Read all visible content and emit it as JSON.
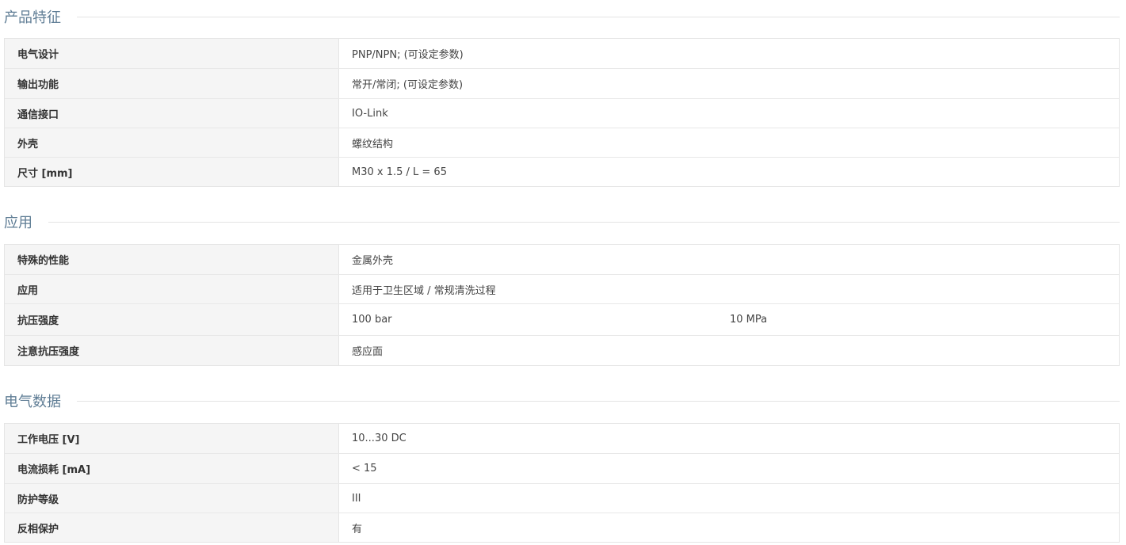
{
  "sections": [
    {
      "title": "产品特征",
      "rows": [
        {
          "label": "电气设计",
          "value": "PNP/NPN; (可设定参数)"
        },
        {
          "label": "输出功能",
          "value": "常开/常闭; (可设定参数)"
        },
        {
          "label": "通信接口",
          "value": "IO-Link"
        },
        {
          "label": "外壳",
          "value": "螺纹结构"
        },
        {
          "label": "尺寸 [mm]",
          "value": "M30 x 1.5 / L = 65"
        }
      ]
    },
    {
      "title": "应用",
      "rows": [
        {
          "label": "特殊的性能",
          "value": "金属外壳"
        },
        {
          "label": "应用",
          "value": "适用于卫生区域 / 常规清洗过程"
        },
        {
          "label": "抗压强度",
          "value": "100 bar",
          "value2": "10 MPa"
        },
        {
          "label": "注意抗压强度",
          "value": "感应面"
        }
      ]
    },
    {
      "title": "电气数据",
      "rows": [
        {
          "label": "工作电压 [V]",
          "value": "10...30 DC"
        },
        {
          "label": "电流损耗 [mA]",
          "value": "< 15"
        },
        {
          "label": "防护等级",
          "value": "III"
        },
        {
          "label": "反相保护",
          "value": "有"
        }
      ]
    }
  ]
}
